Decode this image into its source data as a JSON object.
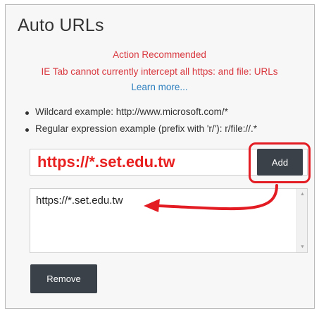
{
  "panel": {
    "title": "Auto URLs"
  },
  "warning": {
    "heading": "Action Recommended",
    "message": "IE Tab cannot currently intercept all https: and file: URLs",
    "learn_more": "Learn more...",
    "heading_color": "#d9383f",
    "link_color": "#2c7fbf"
  },
  "examples": [
    "Wildcard example: http://www.microsoft.com/*",
    "Regular expression example (prefix with 'r/'): r/file://.*"
  ],
  "url_input": {
    "value": "https://*.set.edu.tw",
    "text_color": "#e8201f"
  },
  "buttons": {
    "add_label": "Add",
    "remove_label": "Remove",
    "color": "#3a4149"
  },
  "url_list": {
    "items": [
      "https://*.set.edu.tw"
    ]
  },
  "annotation": {
    "highlight_color": "#e31b23",
    "arrow_color": "#e31b23"
  }
}
